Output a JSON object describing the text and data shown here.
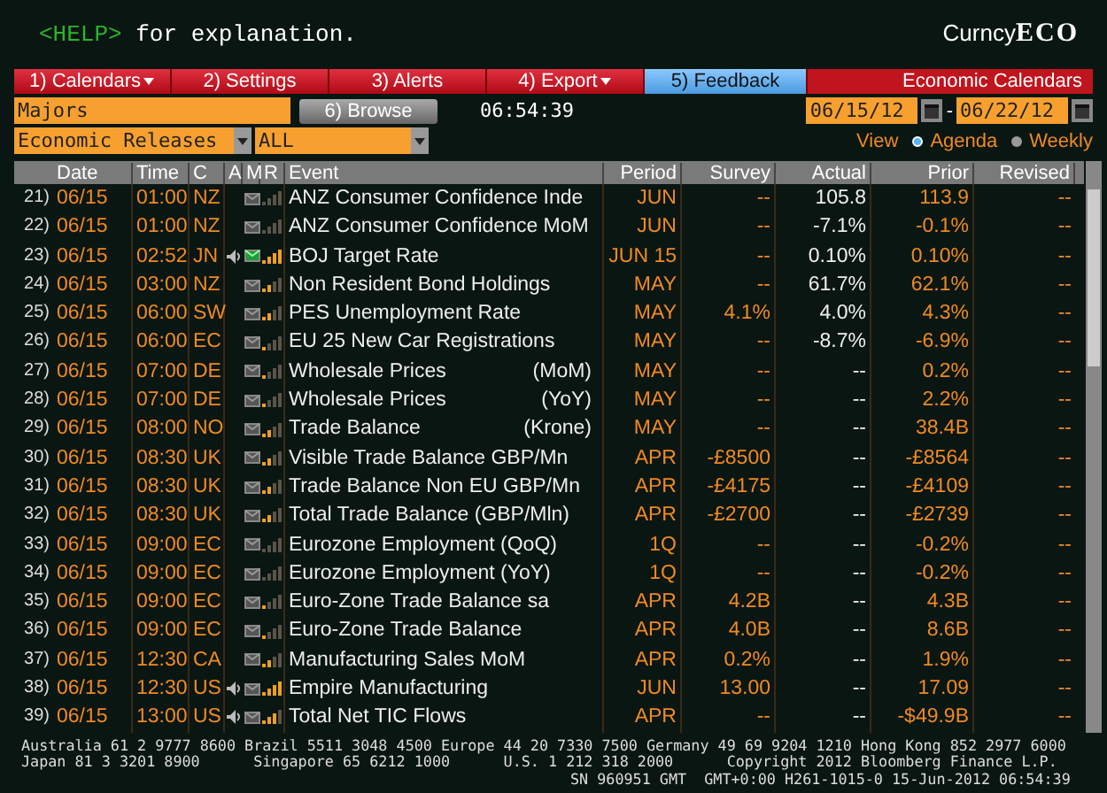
{
  "help": {
    "key": "<HELP>",
    "text": "for explanation."
  },
  "brand": {
    "prefix": "Curncy",
    "name": "ECO"
  },
  "menu": [
    {
      "label": "1) Calendars",
      "dropdown": true,
      "highlighted": false
    },
    {
      "label": "2) Settings",
      "dropdown": false,
      "highlighted": false
    },
    {
      "label": "3) Alerts",
      "dropdown": false,
      "highlighted": false
    },
    {
      "label": "4) Export",
      "dropdown": true,
      "highlighted": false
    },
    {
      "label": "5) Feedback",
      "dropdown": false,
      "highlighted": true
    }
  ],
  "menu_title": "Economic Calendars",
  "region_field": {
    "value": "Majors"
  },
  "browse_button": "6) Browse",
  "clock": "06:54:39",
  "date_from": "06/15/12",
  "date_sep": "-",
  "date_to": "06/22/12",
  "type_select": {
    "value": "Economic Releases"
  },
  "filter_select": {
    "value": "ALL"
  },
  "view": {
    "label": "View",
    "options": [
      {
        "label": "Agenda",
        "selected": true
      },
      {
        "label": "Weekly",
        "selected": false
      }
    ]
  },
  "columns": [
    "Date",
    "Time",
    "C",
    "A",
    "M",
    "R",
    "Event",
    "Period",
    "Survey",
    "Actual",
    "Prior",
    "Revised"
  ],
  "rows": [
    {
      "n": "21)",
      "date": "06/15",
      "time": "01:00",
      "c": "NZ",
      "audio": false,
      "alert": false,
      "kind": "none",
      "event": "ANZ Consumer Confidence Inde",
      "period": "JUN",
      "survey": "--",
      "actual": "105.8",
      "prior": "113.9",
      "revised": "--"
    },
    {
      "n": "22)",
      "date": "06/15",
      "time": "01:00",
      "c": "NZ",
      "audio": false,
      "alert": false,
      "kind": "none",
      "event": "ANZ Consumer Confidence MoM",
      "period": "JUN",
      "survey": "--",
      "actual": "-7.1%",
      "prior": "-0.1%",
      "revised": "--"
    },
    {
      "n": "23)",
      "date": "06/15",
      "time": "02:52",
      "c": "JN",
      "audio": true,
      "alert": true,
      "kind": "top",
      "event": "BOJ Target Rate",
      "period": "JUN 15",
      "survey": "--",
      "actual": "0.10%",
      "prior": "0.10%",
      "revised": "--"
    },
    {
      "n": "24)",
      "date": "06/15",
      "time": "03:00",
      "c": "NZ",
      "audio": false,
      "alert": false,
      "kind": "medium",
      "event": "Non Resident Bond Holdings",
      "period": "MAY",
      "survey": "--",
      "actual": "61.7%",
      "prior": "62.1%",
      "revised": "--"
    },
    {
      "n": "25)",
      "date": "06/15",
      "time": "06:00",
      "c": "SW",
      "audio": false,
      "alert": false,
      "kind": "medium",
      "event": "PES Unemployment Rate",
      "period": "MAY",
      "survey": "4.1%",
      "actual": "4.0%",
      "prior": "4.3%",
      "revised": "--"
    },
    {
      "n": "26)",
      "date": "06/15",
      "time": "06:00",
      "c": "EC",
      "audio": false,
      "alert": false,
      "kind": "low",
      "event": "EU 25 New Car Registrations",
      "period": "MAY",
      "survey": "--",
      "actual": "-8.7%",
      "prior": "-6.9%",
      "revised": "--"
    },
    {
      "n": "27)",
      "date": "06/15",
      "time": "07:00",
      "c": "DE",
      "audio": false,
      "alert": false,
      "kind": "low",
      "event": "Wholesale Prices",
      "suffix": "(MoM)",
      "period": "MAY",
      "survey": "--",
      "actual": "--",
      "prior": "0.2%",
      "revised": "--"
    },
    {
      "n": "28)",
      "date": "06/15",
      "time": "07:00",
      "c": "DE",
      "audio": false,
      "alert": false,
      "kind": "low",
      "event": "Wholesale Prices",
      "suffix": "(YoY)",
      "period": "MAY",
      "survey": "--",
      "actual": "--",
      "prior": "2.2%",
      "revised": "--"
    },
    {
      "n": "29)",
      "date": "06/15",
      "time": "08:00",
      "c": "NO",
      "audio": false,
      "alert": false,
      "kind": "medium",
      "event": "Trade Balance",
      "suffix": "(Krone)",
      "period": "MAY",
      "survey": "--",
      "actual": "--",
      "prior": "38.4B",
      "revised": "--"
    },
    {
      "n": "30)",
      "date": "06/15",
      "time": "08:30",
      "c": "UK",
      "audio": false,
      "alert": false,
      "kind": "medium",
      "event": "Visible Trade Balance GBP/Mn",
      "period": "APR",
      "survey": "-£8500",
      "actual": "--",
      "prior": "-£8564",
      "revised": "--"
    },
    {
      "n": "31)",
      "date": "06/15",
      "time": "08:30",
      "c": "UK",
      "audio": false,
      "alert": false,
      "kind": "medium",
      "event": "Trade Balance Non EU GBP/Mn",
      "period": "APR",
      "survey": "-£4175",
      "actual": "--",
      "prior": "-£4109",
      "revised": "--"
    },
    {
      "n": "32)",
      "date": "06/15",
      "time": "08:30",
      "c": "UK",
      "audio": false,
      "alert": false,
      "kind": "medium",
      "event": "Total Trade Balance (GBP/Mln)",
      "period": "APR",
      "survey": "-£2700",
      "actual": "--",
      "prior": "-£2739",
      "revised": "--"
    },
    {
      "n": "33)",
      "date": "06/15",
      "time": "09:00",
      "c": "EC",
      "audio": false,
      "alert": false,
      "kind": "none",
      "event": "Eurozone Employment (QoQ)",
      "period": "1Q",
      "survey": "--",
      "actual": "--",
      "prior": "-0.2%",
      "revised": "--"
    },
    {
      "n": "34)",
      "date": "06/15",
      "time": "09:00",
      "c": "EC",
      "audio": false,
      "alert": false,
      "kind": "none",
      "event": "Eurozone Employment (YoY)",
      "period": "1Q",
      "survey": "--",
      "actual": "--",
      "prior": "-0.2%",
      "revised": "--"
    },
    {
      "n": "35)",
      "date": "06/15",
      "time": "09:00",
      "c": "EC",
      "audio": false,
      "alert": false,
      "kind": "low",
      "event": "Euro-Zone Trade Balance sa",
      "period": "APR",
      "survey": "4.2B",
      "actual": "--",
      "prior": "4.3B",
      "revised": "--"
    },
    {
      "n": "36)",
      "date": "06/15",
      "time": "09:00",
      "c": "EC",
      "audio": false,
      "alert": false,
      "kind": "low",
      "event": "Euro-Zone Trade Balance",
      "period": "APR",
      "survey": "4.0B",
      "actual": "--",
      "prior": "8.6B",
      "revised": "--"
    },
    {
      "n": "37)",
      "date": "06/15",
      "time": "12:30",
      "c": "CA",
      "audio": false,
      "alert": false,
      "kind": "medium",
      "event": "Manufacturing Sales MoM",
      "period": "APR",
      "survey": "0.2%",
      "actual": "--",
      "prior": "1.9%",
      "revised": "--"
    },
    {
      "n": "38)",
      "date": "06/15",
      "time": "12:30",
      "c": "US",
      "audio": true,
      "alert": false,
      "kind": "top",
      "event": "Empire Manufacturing",
      "period": "JUN",
      "survey": "13.00",
      "actual": "--",
      "prior": "17.09",
      "revised": "--"
    },
    {
      "n": "39)",
      "date": "06/15",
      "time": "13:00",
      "c": "US",
      "audio": true,
      "alert": false,
      "kind": "high",
      "event": "Total Net TIC Flows",
      "period": "APR",
      "survey": "--",
      "actual": "--",
      "prior": "-$49.9B",
      "revised": "--"
    }
  ],
  "footer": [
    "Australia 61 2 9777 8600 Brazil 5511 3048 4500 Europe 44 20 7330 7500 Germany 49 69 9204 1210 Hong Kong 852 2977 6000",
    "Japan 81 3 3201 8900      Singapore 65 6212 1000      U.S. 1 212 318 2000      Copyright 2012 Bloomberg Finance L.P.",
    "SN 960951 GMT  GMT+0:00 H261-1015-0 15-Jun-2012 06:54:39"
  ]
}
